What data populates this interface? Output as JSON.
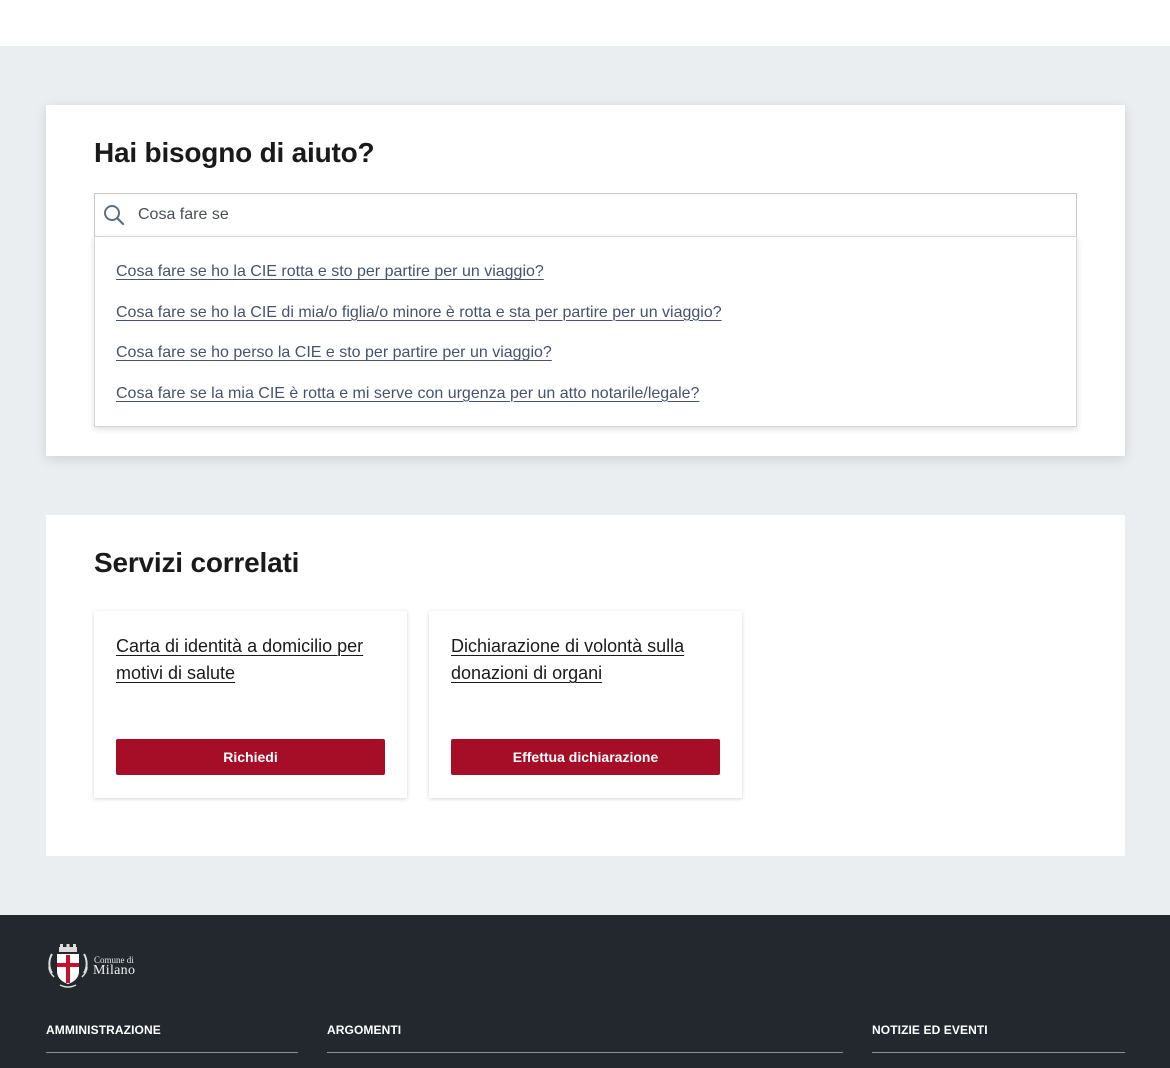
{
  "help": {
    "title": "Hai bisogno di aiuto?",
    "search_value": "Cosa fare se",
    "suggestions": [
      "Cosa fare se ho la CIE rotta e sto per partire per un viaggio?",
      "Cosa fare se ho la CIE di mia/o figlia/o minore è rotta e sta per partire per un viaggio?",
      "Cosa fare se ho perso la CIE e sto per partire per un viaggio?",
      "Cosa fare se la mia CIE è rotta e mi serve con urgenza per un atto notarile/legale?"
    ]
  },
  "services": {
    "title": "Servizi correlati",
    "items": [
      {
        "title": "Carta di identità a domicilio per motivi di salute",
        "button": "Richiedi"
      },
      {
        "title": "Dichiarazione di volontà sulla donazioni di organi",
        "button": "Effettua dichiarazione"
      }
    ]
  },
  "footer": {
    "logo_small": "Comune di",
    "logo_big": "Milano",
    "columns": [
      "AMMINISTRAZIONE",
      "ARGOMENTI",
      "NOTIZIE ED EVENTI"
    ]
  },
  "colors": {
    "button": "#a50e26",
    "footer_bg": "#22282e",
    "page_bg": "#ebeef1",
    "link": "#47536a"
  },
  "icons": [
    "search-icon",
    "milano-coat-of-arms-icon"
  ]
}
